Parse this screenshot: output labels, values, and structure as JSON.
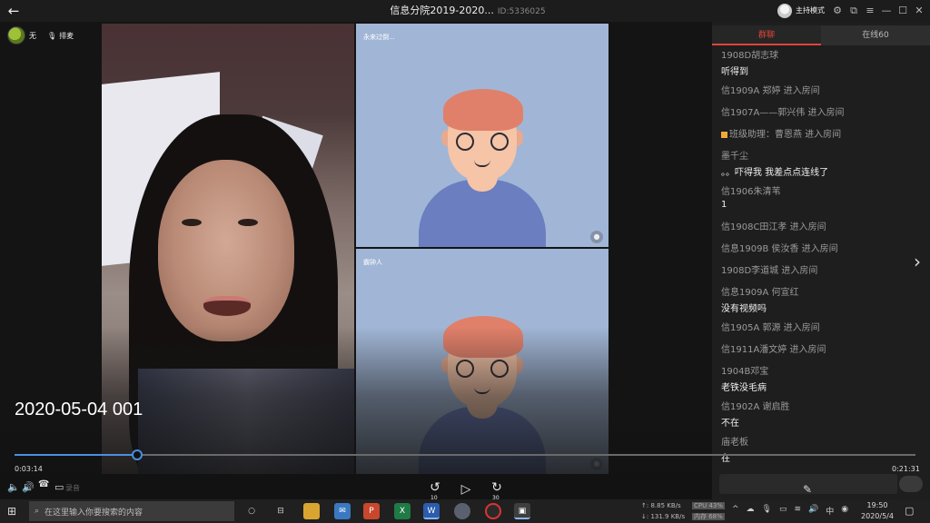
{
  "titlebar": {
    "title": "信息分院2019-2020...",
    "room_id": "ID:5336025",
    "host_mode": "主持模式",
    "icons": [
      "settings-icon",
      "popout-icon",
      "menu-icon",
      "minimize-icon",
      "maximize-icon",
      "close-icon"
    ]
  },
  "top_bar": {
    "mic_user_label": "无",
    "queue_label": "排麦"
  },
  "panels": [
    {
      "name": "永来过倒..."
    },
    {
      "name": "霸钟人"
    }
  ],
  "sidebar": {
    "tab_chat": "群聊",
    "tab_online": "在线60",
    "messages": [
      {
        "name": "1908D胡志球",
        "text": "听得到"
      },
      {
        "name": "信1909A   郑婷 进入房间",
        "text": ""
      },
      {
        "name": "信1907A——郭兴伟 进入房间",
        "text": ""
      },
      {
        "name": "班级助理：曹恩燕 进入房间",
        "text": "",
        "badge": true
      },
      {
        "name": "墨千尘",
        "text": "。。吓得我    我差点点连线了"
      },
      {
        "name": "信1906朱清苇",
        "text": "1"
      },
      {
        "name": "信1908C田江孝 进入房间",
        "text": ""
      },
      {
        "name": "信息1909B 侯汝香 进入房间",
        "text": ""
      },
      {
        "name": "1908D李道城 进入房间",
        "text": ""
      },
      {
        "name": "信息1909A   何宣红",
        "text": "没有视频吗"
      },
      {
        "name": "信1905A 郭源 进入房间",
        "text": ""
      },
      {
        "name": "信1911A潘文婷 进入房间",
        "text": ""
      },
      {
        "name": "1904B邓宝",
        "text": "老铁没毛病"
      },
      {
        "name": "信1902A   谢启胜",
        "text": "不在"
      },
      {
        "name": "庙老板",
        "text": "在"
      }
    ]
  },
  "player": {
    "video_title": "2020-05-04 001",
    "time_current": "0:03:14",
    "time_total": "0:21:31",
    "progress": 0.136,
    "skip_back": "10",
    "skip_forward": "30",
    "record_label": "录音",
    "accent": "#4a8fe0"
  },
  "taskbar": {
    "search_placeholder": "在这里输入你要搜索的内容",
    "net_up": "↑: 8.85 KB/s",
    "net_down": "↓: 131.9 KB/s",
    "cpu": "CPU 43%",
    "mem": "内存 68%",
    "time": "19:50",
    "date": "2020/5/4",
    "ime": "中"
  }
}
